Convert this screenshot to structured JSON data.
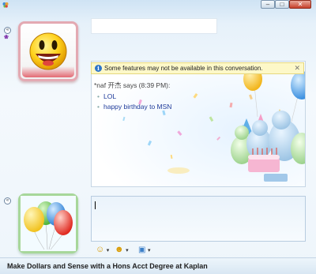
{
  "window": {
    "controls": [
      "–",
      "□",
      "✕"
    ],
    "icons": {
      "system": "msn-butterfly-icon"
    }
  },
  "contact": {
    "collapse_symbol": "«",
    "service_icon": "msn-status-icon",
    "service_mark": "❀",
    "avatar_icon": "smiley-face-icon"
  },
  "infobar": {
    "text": "Some features may not be available in this conversation.",
    "icon": "info-icon",
    "icon_glyph": "i",
    "close": "✕"
  },
  "conversation": {
    "sender_line": "*naf 开杰 says (8:39 PM):",
    "messages": [
      "LOL",
      "happy birthday to MSN"
    ],
    "bullet": "•",
    "background": "birthday-party-scene"
  },
  "self": {
    "collapse_symbol": "«",
    "avatar_icon": "balloons-icon"
  },
  "input": {
    "value": ""
  },
  "toolbar": {
    "emoticon_icon": "smiley-icon",
    "wink_icon": "wink-icon",
    "background_icon": "picture-icon",
    "emoticon_glyph": "☺",
    "wink_glyph": "☻",
    "background_glyph": "▣",
    "dropdown_glyph": "▾"
  },
  "ad": {
    "text": "Make Dollars and Sense with a Hons Acct Degree at Kaplan"
  },
  "colors": {
    "accent": "#2d74c9",
    "message_text": "#1f3b9a",
    "infobar_bg": "#fdf8c8"
  }
}
